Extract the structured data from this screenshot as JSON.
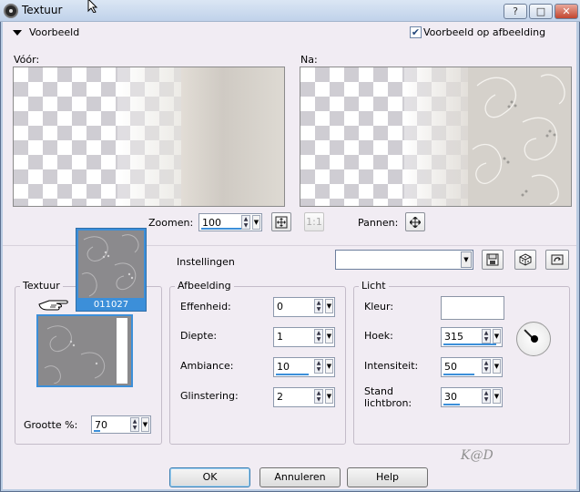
{
  "window": {
    "title": "Textuur",
    "controls": {
      "help": "?",
      "maximize": "□",
      "close": "✕"
    }
  },
  "preview": {
    "toggle_label": "Voorbeeld",
    "preview_on_image_label": "Voorbeeld op afbeelding",
    "preview_on_image_checked": true,
    "before_label": "Vóór:",
    "after_label": "Na:"
  },
  "zoom": {
    "label": "Zoomen:",
    "value": "100",
    "actual_label": "1:1"
  },
  "pan": {
    "label": "Pannen:"
  },
  "settings": {
    "label": "Instellingen",
    "value": ""
  },
  "texture": {
    "group_label": "Textuur",
    "popup_name": "011027",
    "size_label": "Grootte %:",
    "size_value": "70"
  },
  "image_group": {
    "label": "Afbeelding",
    "smoothness_label": "Effenheid:",
    "smoothness_value": "0",
    "depth_label": "Diepte:",
    "depth_value": "1",
    "ambiance_label": "Ambiance:",
    "ambiance_value": "10",
    "gloss_label": "Glinstering:",
    "gloss_value": "2"
  },
  "light_group": {
    "label": "Licht",
    "color_label": "Kleur:",
    "color_value": "#ffffff",
    "angle_label": "Hoek:",
    "angle_value": "315",
    "intensity_label": "Intensiteit:",
    "intensity_value": "50",
    "elevation_label_line1": "Stand",
    "elevation_label_line2": "lichtbron:",
    "elevation_value": "30"
  },
  "buttons": {
    "ok": "OK",
    "cancel": "Annuleren",
    "help": "Help"
  },
  "watermark": "K@D",
  "icons": [
    "app-icon",
    "zoom-fit-icon",
    "pan-icon",
    "save-icon",
    "random-icon",
    "reset-icon",
    "hand-pointer-icon",
    "angle-dial-icon"
  ]
}
